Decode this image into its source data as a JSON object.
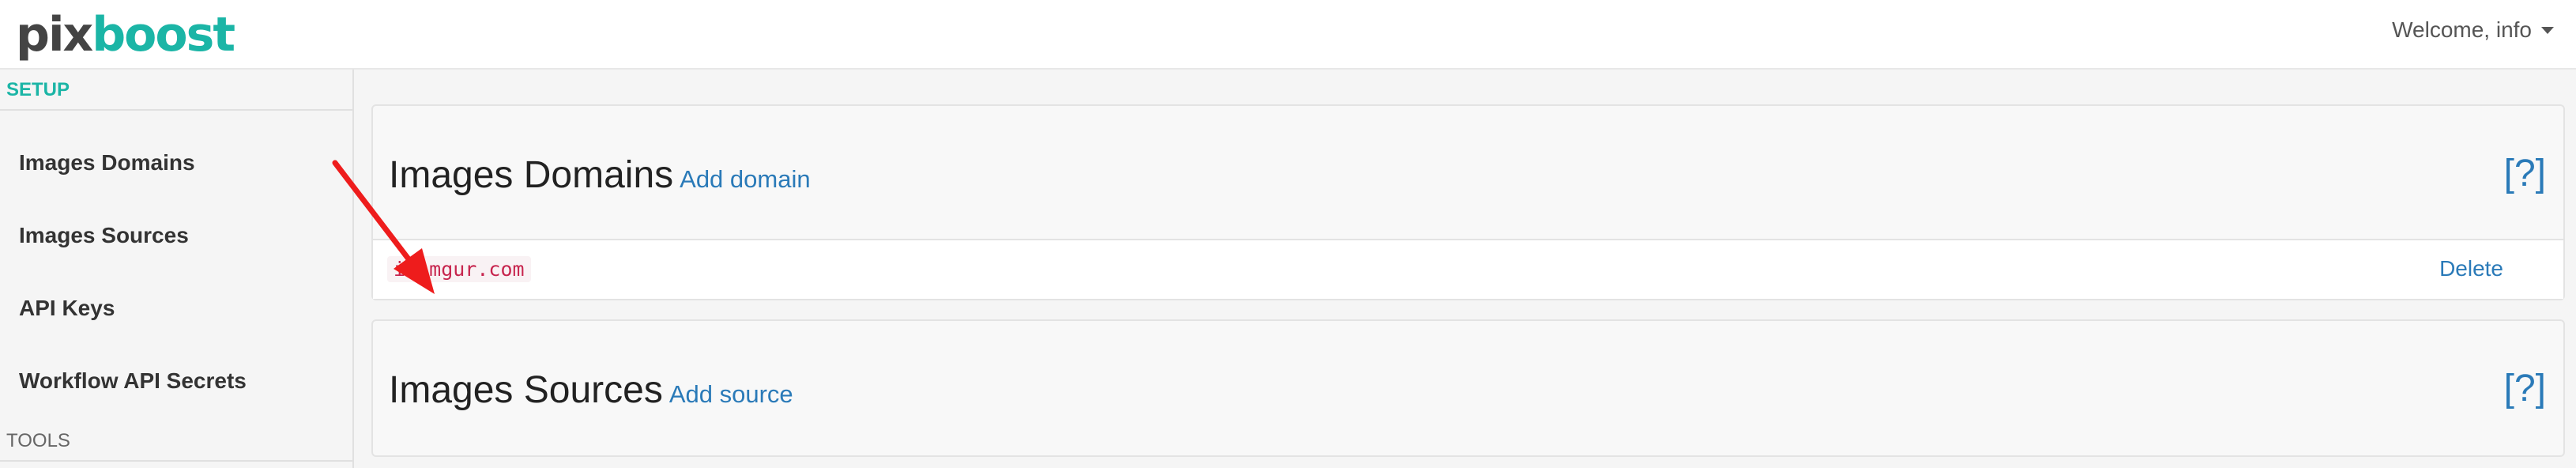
{
  "header": {
    "logo_part1": "pix",
    "logo_part2": "boost",
    "welcome": "Welcome, info"
  },
  "sidebar": {
    "setup_heading": "SETUP",
    "items": [
      {
        "label": "Images Domains"
      },
      {
        "label": "Images Sources"
      },
      {
        "label": "API Keys"
      },
      {
        "label": "Workflow API Secrets"
      }
    ],
    "tools_heading": "TOOLS"
  },
  "main": {
    "domains_panel": {
      "title": "Images Domains",
      "add_link": "Add domain",
      "help": "[?]",
      "rows": [
        {
          "domain": "i.imgur.com",
          "action": "Delete"
        }
      ]
    },
    "sources_panel": {
      "title": "Images Sources",
      "add_link": "Add source",
      "help": "[?]"
    }
  },
  "colors": {
    "accent": "#1bb5a6",
    "link": "#2a7ab8",
    "code_text": "#c7254e",
    "annotation_arrow": "#ee1c1c"
  },
  "annotation": {
    "type": "red arrow",
    "points_to": "i.imgur.com"
  }
}
